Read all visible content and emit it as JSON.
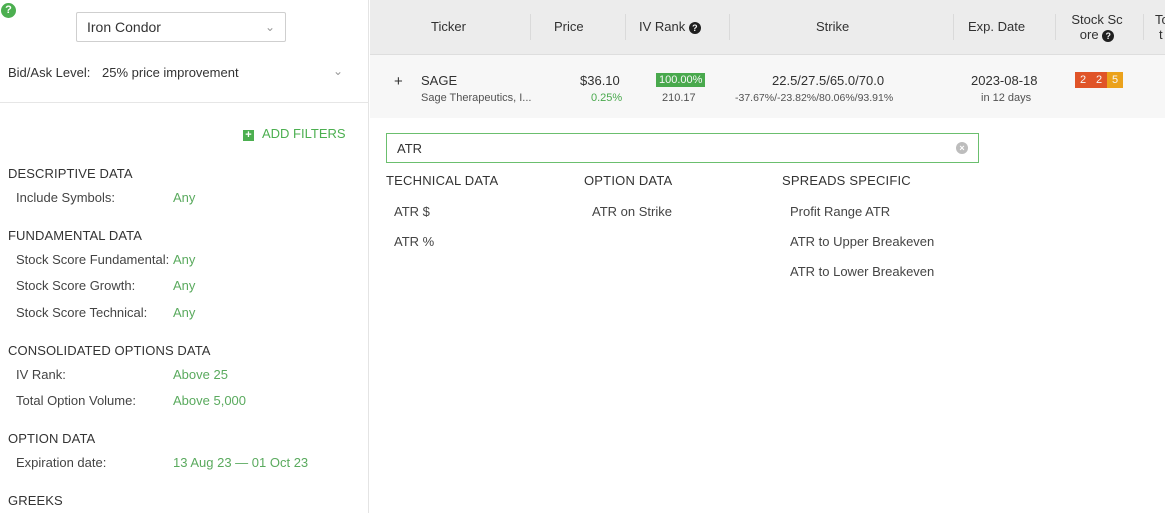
{
  "sidebar": {
    "help_glyph": "?",
    "strategy": {
      "value": "Iron Condor",
      "chevron": "chevron-down-icon"
    },
    "bid_ask": {
      "label": "Bid/Ask Level:",
      "value": "25% price improvement"
    },
    "add_filters": {
      "plus": "+",
      "label": "ADD FILTERS"
    },
    "sections": [
      {
        "title": "DESCRIPTIVE DATA",
        "rows": [
          {
            "label": "Include Symbols:",
            "value": "Any"
          }
        ]
      },
      {
        "title": "FUNDAMENTAL DATA",
        "rows": [
          {
            "label": "Stock Score Fundamental:",
            "value": "Any"
          },
          {
            "label": "Stock Score Growth:",
            "value": "Any"
          },
          {
            "label": "Stock Score Technical:",
            "value": "Any"
          }
        ]
      },
      {
        "title": "CONSOLIDATED OPTIONS DATA",
        "rows": [
          {
            "label": "IV Rank:",
            "value": "Above 25"
          },
          {
            "label": "Total Option Volume:",
            "value": "Above 5,000"
          }
        ]
      },
      {
        "title": "OPTION DATA",
        "rows": [
          {
            "label": "Expiration date:",
            "value": "13 Aug 23 — 01 Oct 23"
          }
        ]
      },
      {
        "title": "GREEKS",
        "rows": []
      }
    ]
  },
  "table": {
    "columns": [
      "Ticker",
      "Price",
      "IV Rank",
      "Strike",
      "Exp. Date",
      "Stock Sc",
      "ore",
      "To",
      "t"
    ],
    "help_glyph": "?",
    "row": {
      "expand": "+",
      "ticker": "SAGE",
      "company": "Sage Therapeutics, I...",
      "price": "$36.10",
      "price_change": "0.25%",
      "iv_rank_badge": "100.00%",
      "iv_value": "210.17",
      "strike": "22.5/27.5/65.0/70.0",
      "strike_pct": "-37.67%/-23.82%/80.06%/93.91%",
      "exp_date": "2023-08-18",
      "exp_days": "in 12 days",
      "scores": [
        {
          "value": "2",
          "color": "#e8572a"
        },
        {
          "value": "2",
          "color": "#e8572a"
        },
        {
          "value": "5",
          "color": "#f3a81d"
        }
      ]
    }
  },
  "filter_dropdown": {
    "search_value": "ATR",
    "clear_glyph": "×",
    "columns": [
      {
        "title": "TECHNICAL DATA",
        "options": [
          "ATR $",
          "ATR %"
        ]
      },
      {
        "title": "OPTION DATA",
        "options": [
          "ATR on Strike"
        ]
      },
      {
        "title": "SPREADS SPECIFIC",
        "options": [
          "Profit Range ATR",
          "ATR to Upper Breakeven",
          "ATR to Lower Breakeven"
        ]
      }
    ]
  },
  "colors": {
    "accent": "#4caf50",
    "score_red": "#e8572a",
    "score_orange": "#f3a81d"
  }
}
